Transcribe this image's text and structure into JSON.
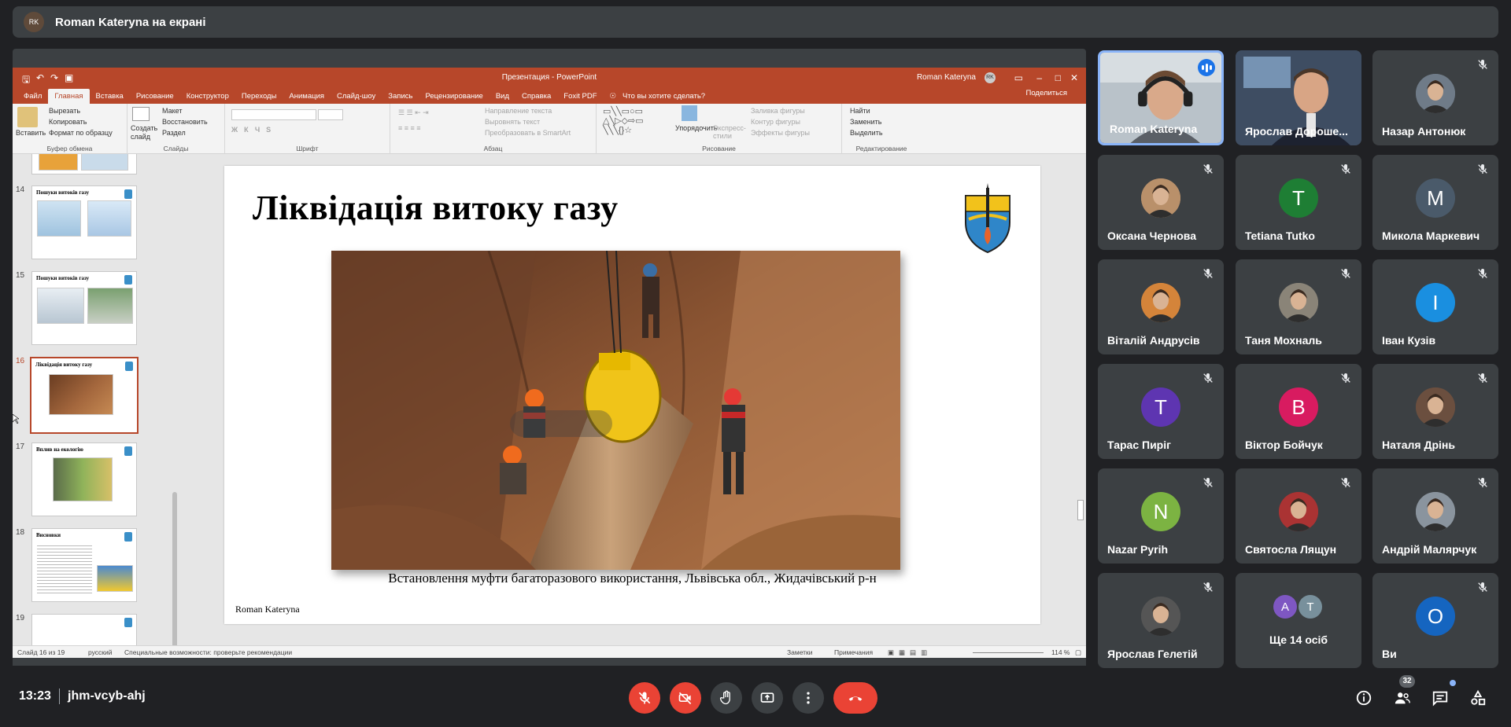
{
  "topbar": {
    "presenter_text": "Roman Kateryna на екрані",
    "avatar_text": "RK"
  },
  "ppt": {
    "window_title": "Презентация - PowerPoint",
    "user": "Roman Kateryna",
    "user_initials": "RK",
    "tabs": [
      "Файл",
      "Главная",
      "Вставка",
      "Рисование",
      "Конструктор",
      "Переходы",
      "Анимация",
      "Слайд-шоу",
      "Запись",
      "Рецензирование",
      "Вид",
      "Справка",
      "Foxit PDF"
    ],
    "tell_me": "Что вы хотите сделать?",
    "share_label": "Поделиться",
    "ribbon": {
      "paste": "Вставить",
      "cut": "Вырезать",
      "copy": "Копировать",
      "format_painter": "Формат по образцу",
      "clipboard": "Буфер обмена",
      "new_slide": "Создать слайд",
      "layout": "Макет",
      "reset": "Восстановить",
      "section": "Раздел",
      "slides": "Слайды",
      "font": "Шрифт",
      "text_direction": "Направление текста",
      "align_text": "Выровнять текст",
      "smartart": "Преобразовать в SmartArt",
      "paragraph": "Абзац",
      "arrange": "Упорядочить",
      "quick_styles": "Экспресс-стили",
      "shape_fill": "Заливка фигуры",
      "shape_outline": "Контур фигуры",
      "shape_effects": "Эффекты фигуры",
      "drawing": "Рисование",
      "find": "Найти",
      "replace": "Заменить",
      "select": "Выделить",
      "editing": "Редактирование"
    },
    "thumbs": [
      {
        "num": "14",
        "title": "Пошуки витоків газу"
      },
      {
        "num": "15",
        "title": "Пошуки витоків газу"
      },
      {
        "num": "16",
        "title": "Ліквідація витоку газу"
      },
      {
        "num": "17",
        "title": "Вплив на екологію"
      },
      {
        "num": "18",
        "title": "Висновки"
      },
      {
        "num": "19",
        "title": ""
      }
    ],
    "slide": {
      "title": "Ліквідація витоку газу",
      "caption": "Встановлення муфти багаторазового використання, Львівська обл., Жидачівський р-н",
      "author": "Roman Kateryna"
    },
    "status": {
      "slide_of": "Слайд 16 из 19",
      "language": "русский",
      "accessibility": "Специальные возможности: проверьте рекомендации",
      "notes": "Заметки",
      "comments": "Примечания",
      "zoom": "114 %"
    }
  },
  "participants": [
    {
      "name": "Roman Kateryna",
      "initial": "",
      "color": "",
      "type": "video",
      "muted": false
    },
    {
      "name": "Ярослав Дороше...",
      "initial": "",
      "color": "",
      "type": "video",
      "muted": false
    },
    {
      "name": "Назар Антонюк",
      "initial": "",
      "color": "#6f7b88",
      "type": "photo",
      "muted": true
    },
    {
      "name": "Оксана Чернова",
      "initial": "",
      "color": "#b9906a",
      "type": "photo",
      "muted": true
    },
    {
      "name": "Tetiana Tutko",
      "initial": "T",
      "color": "#1e7e34",
      "type": "letter",
      "muted": true
    },
    {
      "name": "Микола Маркевич",
      "initial": "M",
      "color": "#4a5a6a",
      "type": "letter",
      "muted": true
    },
    {
      "name": "Віталій Андрусів",
      "initial": "",
      "color": "#d4843a",
      "type": "photo",
      "muted": true
    },
    {
      "name": "Таня Мохналь",
      "initial": "",
      "color": "#8a8478",
      "type": "photo",
      "muted": true
    },
    {
      "name": "Іван Кузів",
      "initial": "I",
      "color": "#1a8fe0",
      "type": "letter",
      "muted": true
    },
    {
      "name": "Тарас Пиріг",
      "initial": "T",
      "color": "#5e35b1",
      "type": "letter",
      "muted": true
    },
    {
      "name": "Віктор Бойчук",
      "initial": "B",
      "color": "#d81b60",
      "type": "letter",
      "muted": true
    },
    {
      "name": "Наталя Дрінь",
      "initial": "",
      "color": "#6b4f3f",
      "type": "photo",
      "muted": true
    },
    {
      "name": "Nazar Pyrih",
      "initial": "N",
      "color": "#7cb342",
      "type": "letter",
      "muted": true
    },
    {
      "name": "Святосла Лящун",
      "initial": "",
      "color": "#a33",
      "type": "photo",
      "muted": true
    },
    {
      "name": "Андрій Малярчук",
      "initial": "",
      "color": "#8a949e",
      "type": "photo",
      "muted": true
    },
    {
      "name": "Ярослав Гелетій",
      "initial": "",
      "color": "#555",
      "type": "photo",
      "muted": true
    },
    {
      "name": "Ще 14 осіб",
      "initial": "",
      "color": "",
      "type": "more",
      "muted": false
    },
    {
      "name": "Ви",
      "initial": "O",
      "color": "#1565c0",
      "type": "letter",
      "muted": true
    }
  ],
  "more_initials": [
    "A",
    "T"
  ],
  "bottom": {
    "time": "13:23",
    "meeting_code": "jhm-vcyb-ahj",
    "participant_count": "32"
  },
  "colors": {
    "accent": "#b7472a",
    "meet_bg": "#202124",
    "tile_bg": "#3c4043",
    "end_call": "#ea4335",
    "speaking": "#1a73e8"
  }
}
